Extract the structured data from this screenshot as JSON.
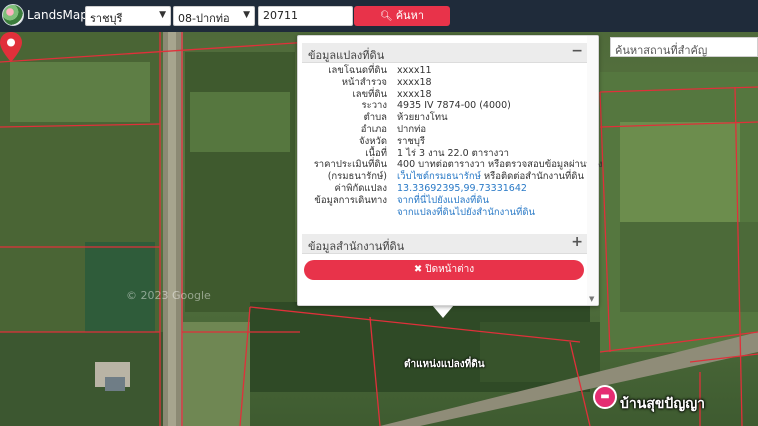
{
  "navbar": {
    "brand": "LandsMaps",
    "province_select": "ราชบุรี",
    "district_select": "08-ปากท่อ",
    "parcel_code": "20711",
    "search_button": "ค้นหา"
  },
  "map": {
    "place_search_placeholder": "ค้นหาสถานที่สำคัญ",
    "watermark": "© 2023 Google",
    "pin_label": "ตำแหน่งแปลงที่ดิน",
    "poi_label": "บ้านสุขปัญญา"
  },
  "popup": {
    "section1_title": "ข้อมูลแปลงที่ดิน",
    "section1_toggle": "−",
    "rows": [
      {
        "label": "เลขโฉนดที่ดิน",
        "value": "xxxx11"
      },
      {
        "label": "หน้าสำรวจ",
        "value": "xxxx18"
      },
      {
        "label": "เลขที่ดิน",
        "value": "xxxx18"
      },
      {
        "label": "ระวาง",
        "value": "4935 IV 7874-00 (4000)"
      },
      {
        "label": "ตำบล",
        "value": "ห้วยยางโทน"
      },
      {
        "label": "อำเภอ",
        "value": "ปากท่อ"
      },
      {
        "label": "จังหวัด",
        "value": "ราชบุรี"
      },
      {
        "label": "เนื้อที่",
        "value": "1 ไร่ 3 งาน 22.0 ตารางวา"
      },
      {
        "label": "ราคาประเมินที่ดิน",
        "value": "400 บาทต่อตารางวา หรือตรวจสอบข้อมูลผ่านทาง"
      },
      {
        "label": "(กรมธนารักษ์)",
        "value_link": "เว็บไซต์กรมธนารักษ์",
        "value_suffix": " หรือติดต่อสำนักงานที่ดิน"
      },
      {
        "label": "ค่าพิกัดแปลง",
        "value_link": "13.33692395,99.73331642"
      },
      {
        "label": "ข้อมูลการเดินทาง",
        "value_link": "จากที่นี่ไปยังแปลงที่ดิน"
      },
      {
        "label": "",
        "value_link": "จากแปลงที่ดินไปยังสำนักงานที่ดิน"
      }
    ],
    "section2_title": "ข้อมูลสำนักงานที่ดิน",
    "section2_toggle": "+",
    "close_button": "ปิดหน้าต่าง"
  },
  "colors": {
    "navbar_bg": "#1f2b3a",
    "accent_red": "#e8334a",
    "link_blue": "#2a7ac7",
    "parcel_border": "#e0303a",
    "poi_pink": "#e52d72"
  }
}
